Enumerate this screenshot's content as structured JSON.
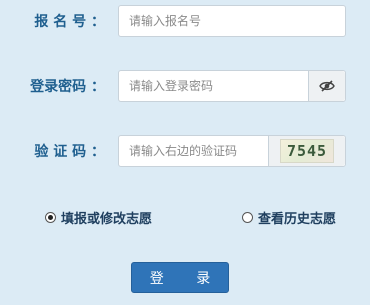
{
  "form": {
    "id_label": "报 名 号 ：",
    "id_placeholder": "请输入报名号",
    "password_label": "登录密码 ：",
    "password_placeholder": "请输入登录密码",
    "captcha_label": "验 证 码 ：",
    "captcha_placeholder": "请输入右边的验证码",
    "captcha_text": "7545"
  },
  "options": {
    "fill_label": "填报或修改志愿",
    "history_label": "查看历史志愿",
    "selected": "fill"
  },
  "actions": {
    "login_label": "登 录"
  },
  "icons": {
    "password_toggle": "eye-slash-icon"
  },
  "colors": {
    "background": "#dcebf5",
    "label_text": "#1f5f8f",
    "button": "#2f74b8"
  }
}
